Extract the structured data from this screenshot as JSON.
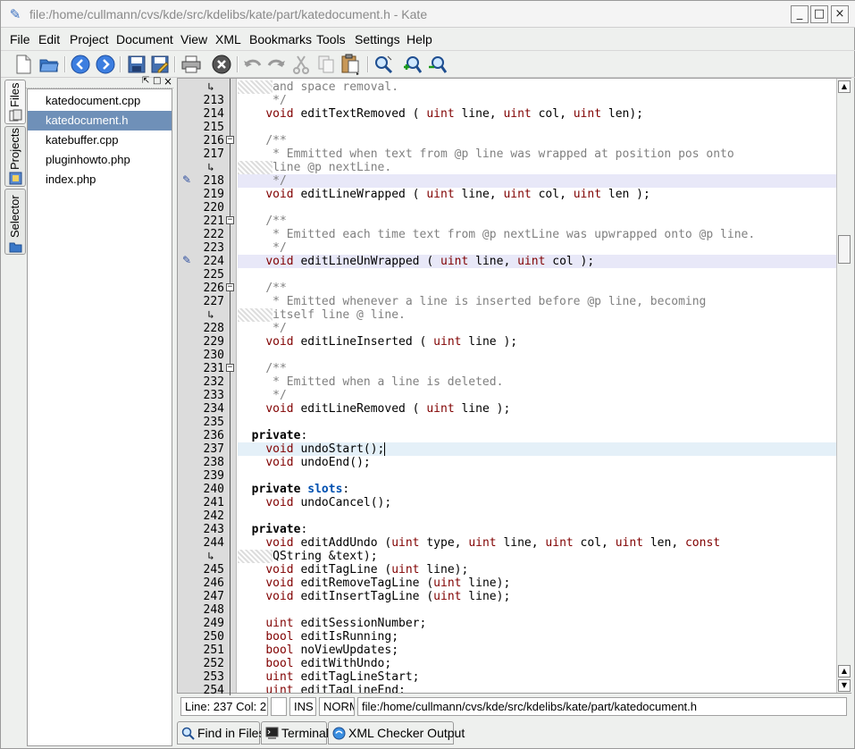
{
  "window": {
    "title": "file:/home/cullmann/cvs/kde/src/kdelibs/kate/part/katedocument.h - Kate",
    "buttons": {
      "minimize": "_",
      "maximize": "□",
      "close": "×"
    }
  },
  "menubar": {
    "items": [
      {
        "label": "File",
        "accel": "F"
      },
      {
        "label": "Edit",
        "accel": "E"
      },
      {
        "label": "Project",
        "accel": "P"
      },
      {
        "label": "Document",
        "accel": "D"
      },
      {
        "label": "View",
        "accel": "V"
      },
      {
        "label": "XML",
        "accel": "X"
      },
      {
        "label": "Bookmarks",
        "accel": "B"
      },
      {
        "label": "Tools",
        "accel": "T"
      },
      {
        "label": "Settings",
        "accel": "S"
      },
      {
        "label": "Help",
        "accel": "H"
      }
    ]
  },
  "toolbar": {
    "icons": [
      "new-document-icon",
      "open-folder-icon",
      "back-icon",
      "forward-icon",
      "save-icon",
      "save-as-icon",
      "print-icon",
      "close-document-icon",
      "undo-icon",
      "redo-icon",
      "cut-icon",
      "copy-icon",
      "paste-icon",
      "find-icon",
      "find-next-icon",
      "find-previous-icon"
    ]
  },
  "sidebar": {
    "tabs": [
      {
        "label": "Files",
        "icon": "files-icon",
        "active": true
      },
      {
        "label": "Projects",
        "icon": "projects-icon",
        "active": false
      },
      {
        "label": "Selector",
        "icon": "selector-icon",
        "active": false
      }
    ],
    "header_buttons": {
      "undock": "⇱",
      "float": "□",
      "close": "×"
    },
    "files": [
      {
        "name": "katedocument.cpp",
        "selected": false
      },
      {
        "name": "katedocument.h",
        "selected": true
      },
      {
        "name": "katebuffer.cpp",
        "selected": false
      },
      {
        "name": "pluginhowto.php",
        "selected": false
      },
      {
        "name": "index.php",
        "selected": false
      }
    ]
  },
  "editor": {
    "line_numbers": [
      "",
      "213",
      "214",
      "215",
      "216",
      "217",
      "",
      "218",
      "219",
      "220",
      "221",
      "222",
      "223",
      "224",
      "225",
      "226",
      "227",
      "",
      "228",
      "229",
      "230",
      "231",
      "232",
      "233",
      "234",
      "235",
      "236",
      "237",
      "238",
      "239",
      "240",
      "241",
      "242",
      "243",
      "244",
      "",
      "245",
      "246",
      "247",
      "248",
      "249",
      "250",
      "251",
      "252",
      "253",
      "254"
    ],
    "cursor_line": "237",
    "bookmarked_lines": [
      "218",
      "224"
    ]
  },
  "statusbar": {
    "position": "Line: 237 Col: 21",
    "blank": "",
    "insert_mode": "INS",
    "edit_mode": "NORM",
    "path": "file:/home/cullmann/cvs/kde/src/kdelibs/kate/part/katedocument.h"
  },
  "bottom_tabs": [
    {
      "label": "Find in Files",
      "icon": "find-in-files-icon"
    },
    {
      "label": "Terminal",
      "icon": "terminal-icon"
    },
    {
      "label": "XML Checker Output",
      "icon": "xml-checker-icon"
    }
  ]
}
